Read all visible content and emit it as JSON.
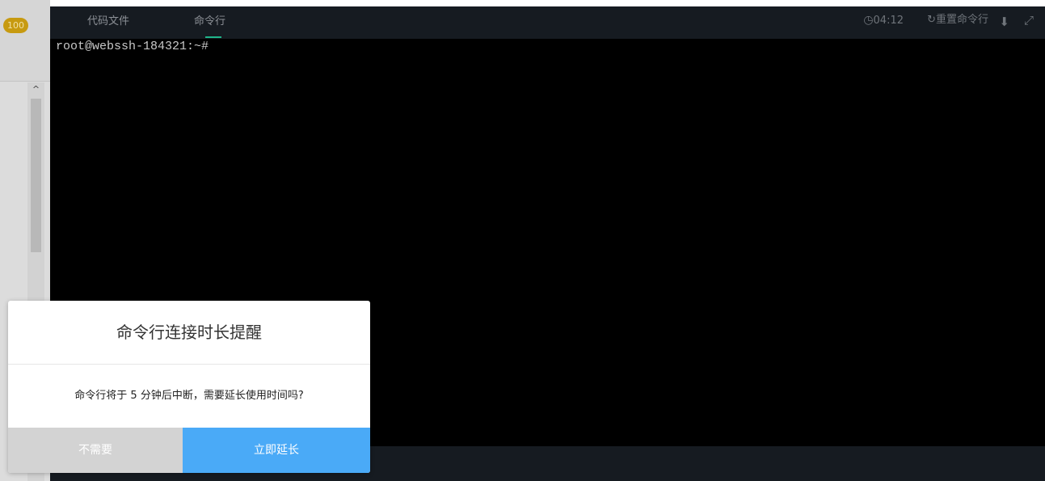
{
  "sidebar": {
    "score_badge": "100",
    "scroll_up_icon": "chevron-up-icon"
  },
  "header": {
    "tabs": [
      {
        "label": "代码文件"
      },
      {
        "label": "命令行",
        "active": true
      }
    ],
    "timer": {
      "icon": "clock-icon",
      "value": "04:12"
    },
    "reset": {
      "icon": "reset-icon",
      "label": "重置命令行"
    },
    "download_icon": "download-icon",
    "fullscreen_icon": "fullscreen-icon"
  },
  "terminal": {
    "prompt": "root@webssh-184321:~#"
  },
  "dialog": {
    "title": "命令行连接时长提醒",
    "message": "命令行将于 5 分钟后中断，需要延长使用时间吗?",
    "cancel_label": "不需要",
    "confirm_label": "立即延长"
  },
  "colors": {
    "terminal_bg": "#000000",
    "bar_bg": "#161b21",
    "accent_tab": "#1fb58a",
    "confirm_button": "#4aaaf7",
    "cancel_button": "#d3d3d3",
    "badge": "#c79a10"
  }
}
